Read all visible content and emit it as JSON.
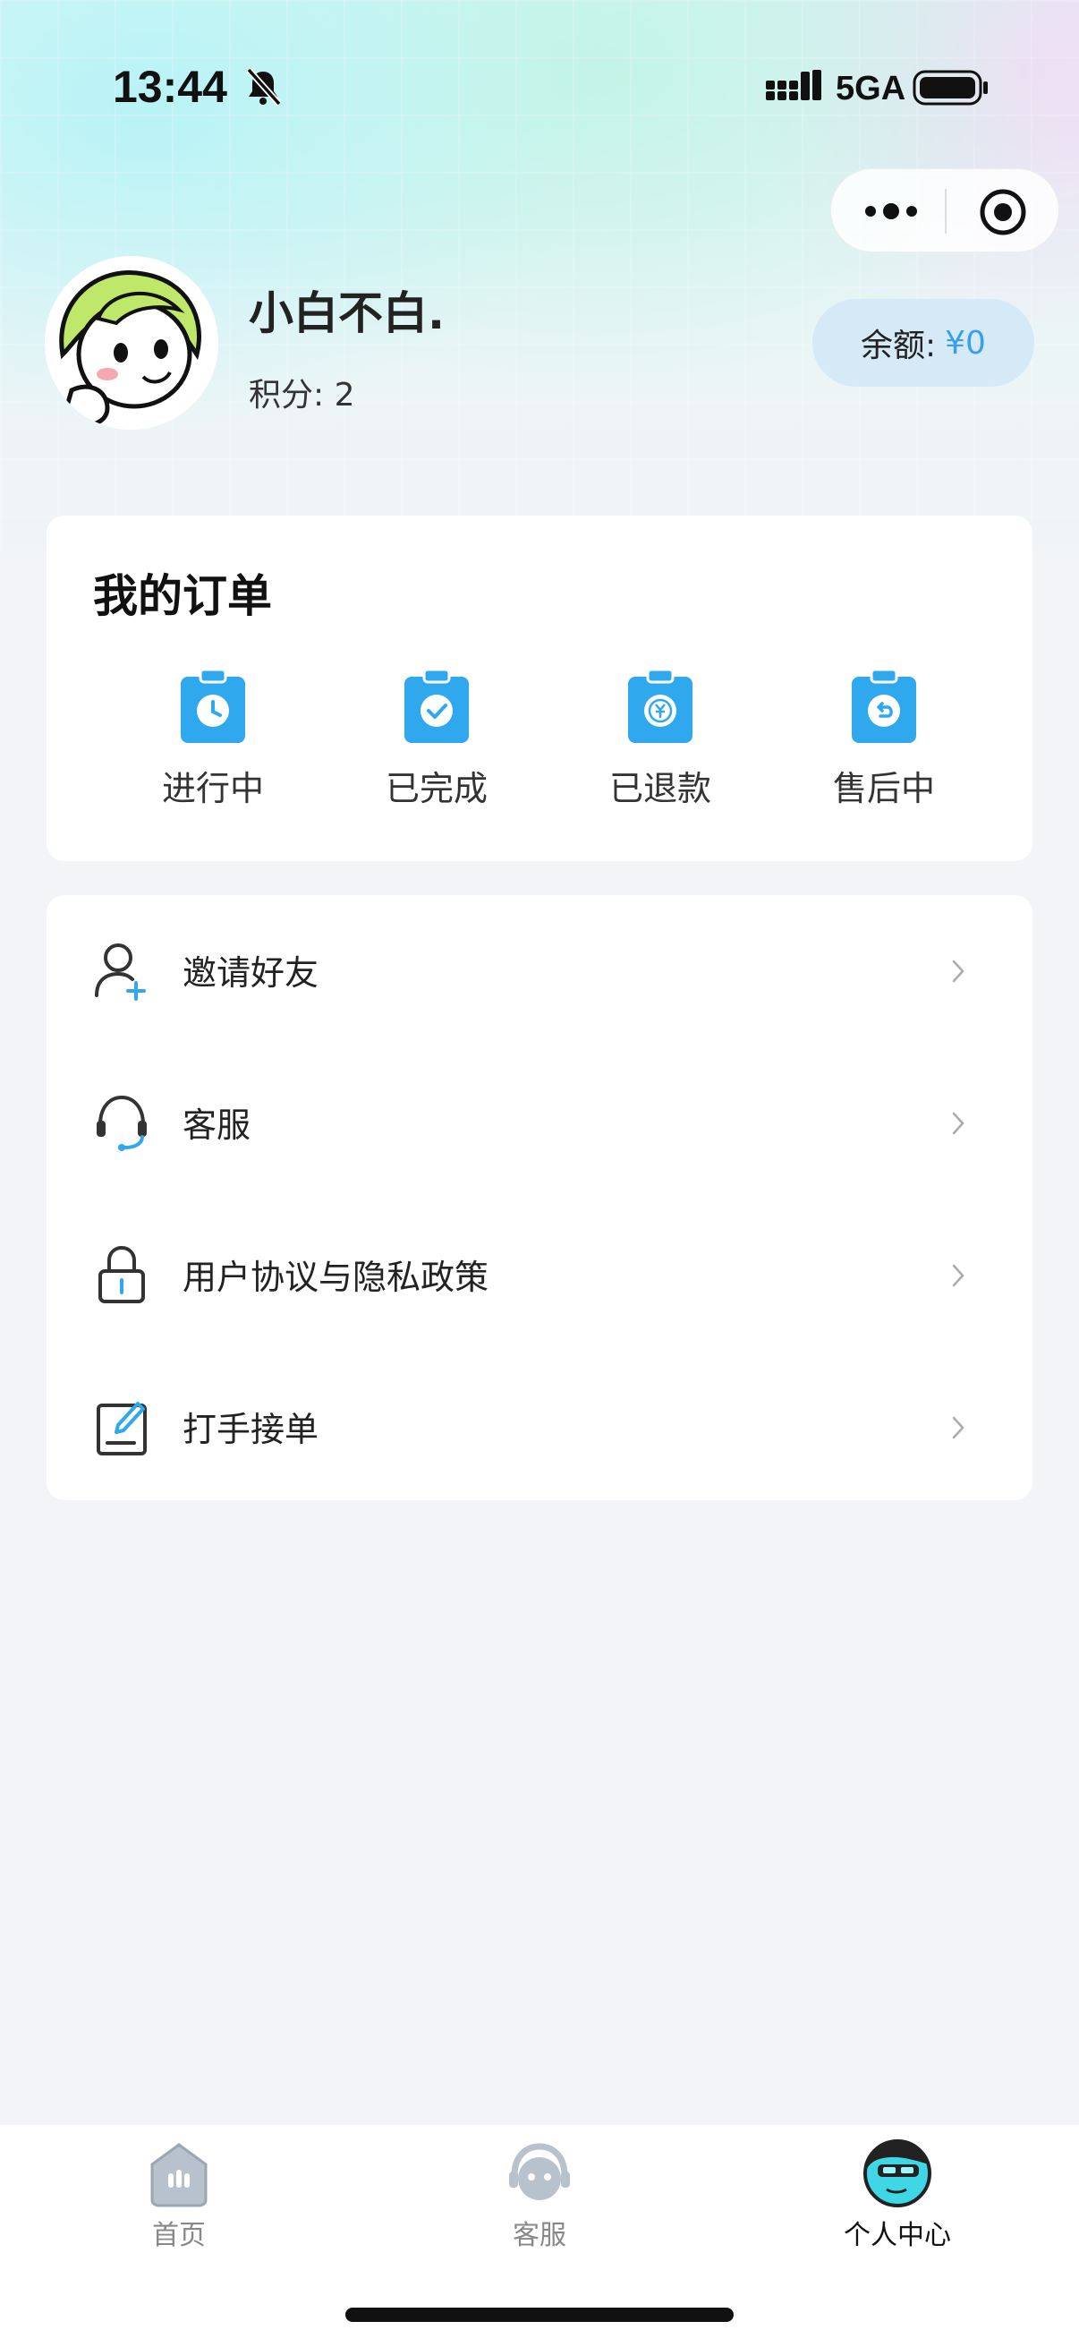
{
  "status_bar": {
    "time": "13:44",
    "network": "5GA"
  },
  "profile": {
    "username": "小白不白.",
    "points": "积分: 2",
    "balance_label": "余额:",
    "balance_value": "¥0"
  },
  "orders": {
    "title": "我的订单",
    "items": [
      {
        "label": "进行中",
        "icon": "clock-clipboard-icon"
      },
      {
        "label": "已完成",
        "icon": "check-clipboard-icon"
      },
      {
        "label": "已退款",
        "icon": "refund-clipboard-icon"
      },
      {
        "label": "售后中",
        "icon": "return-clipboard-icon"
      }
    ]
  },
  "menu": {
    "items": [
      {
        "label": "邀请好友",
        "icon": "add-user-icon"
      },
      {
        "label": "客服",
        "icon": "headset-icon"
      },
      {
        "label": "用户协议与隐私政策",
        "icon": "lock-icon"
      },
      {
        "label": "打手接单",
        "icon": "edit-note-icon"
      }
    ]
  },
  "tab_bar": {
    "tabs": [
      {
        "label": "首页",
        "icon": "home-robot-icon",
        "active": false
      },
      {
        "label": "客服",
        "icon": "service-robot-icon",
        "active": false
      },
      {
        "label": "个人中心",
        "icon": "profile-character-icon",
        "active": true
      }
    ]
  },
  "colors": {
    "accent_blue": "#3b9ded",
    "icon_blue": "#2fa8ee",
    "page_bg": "#f3f4f7",
    "balance_pill": "#d5e9f6"
  }
}
